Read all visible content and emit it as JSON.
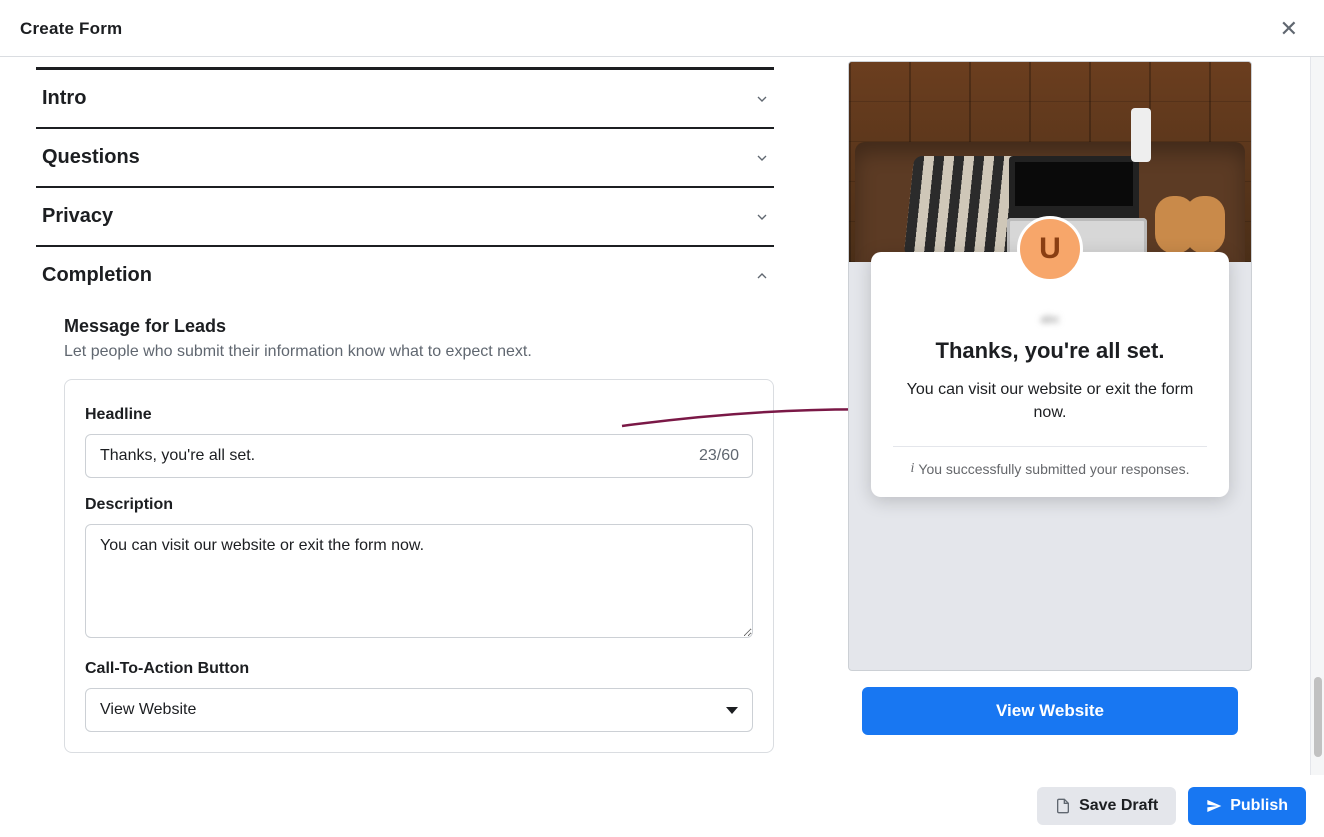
{
  "header": {
    "title": "Create Form"
  },
  "sections": [
    {
      "label": "Intro",
      "expanded": false
    },
    {
      "label": "Questions",
      "expanded": false
    },
    {
      "label": "Privacy",
      "expanded": false
    },
    {
      "label": "Completion",
      "expanded": true
    }
  ],
  "completion": {
    "heading": "Message for Leads",
    "subtext": "Let people who submit their information know what to expect next.",
    "fields": {
      "headline_label": "Headline",
      "headline_value": "Thanks, you're all set.",
      "headline_counter": "23/60",
      "description_label": "Description",
      "description_value": "You can visit our website or exit the form now.",
      "cta_label": "Call-To-Action Button",
      "cta_value": "View Website"
    }
  },
  "preview": {
    "avatar_letter": "U",
    "headline": "Thanks, you're all set.",
    "description": "You can visit our website or exit the form now.",
    "submit_note": "You successfully submitted your responses.",
    "cta_button": "View Website"
  },
  "footer": {
    "save_draft": "Save Draft",
    "publish": "Publish"
  }
}
